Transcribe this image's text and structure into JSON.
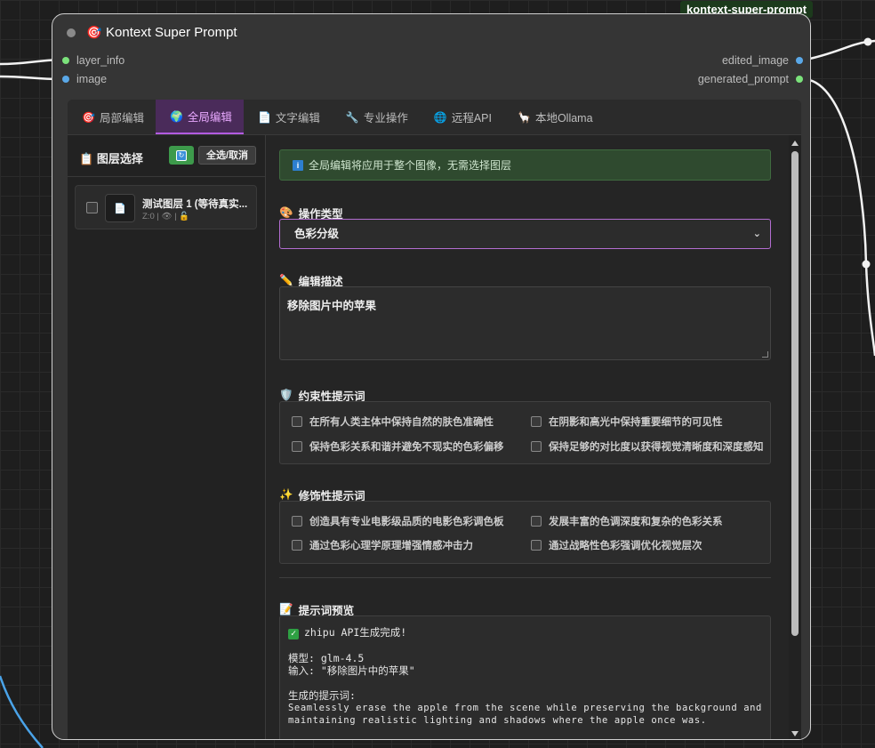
{
  "node": {
    "tag": "kontext-super-prompt",
    "title_icon": "🎯",
    "title": "Kontext Super Prompt",
    "inputs": [
      {
        "label": "layer_info",
        "color": "#7be27b"
      },
      {
        "label": "image",
        "color": "#5aa8e8"
      }
    ],
    "outputs": [
      {
        "label": "edited_image",
        "color": "#5aa8e8"
      },
      {
        "label": "generated_prompt",
        "color": "#7be27b"
      }
    ]
  },
  "tabs": [
    {
      "icon": "🎯",
      "label": "局部编辑"
    },
    {
      "icon": "🌍",
      "label": "全局编辑"
    },
    {
      "icon": "📄",
      "label": "文字编辑"
    },
    {
      "icon": "🔧",
      "label": "专业操作"
    },
    {
      "icon": "🌐",
      "label": "远程API"
    },
    {
      "icon": "🦙",
      "label": "本地Ollama"
    }
  ],
  "active_tab": "全局编辑",
  "layer_panel": {
    "icon": "📋",
    "title": "图层选择",
    "refresh_icon": "refresh-icon",
    "select_all_label": "全选/取消",
    "layers": [
      {
        "name": "测试图层 1 (等待真实...",
        "meta": "Z:0 | 👁 | 🔓",
        "icon": "📄"
      }
    ]
  },
  "global_edit": {
    "info": "全局编辑将应用于整个图像，无需选择图层",
    "operation_label": "操作类型",
    "operation_icon": "🎨",
    "operation_value": "色彩分级",
    "description_label": "编辑描述",
    "description_icon": "✏️",
    "description_value": "移除图片中的苹果",
    "constraint_label": "约束性提示词",
    "constraint_icon": "🛡️",
    "constraints": [
      "在所有人类主体中保持自然的肤色准确性",
      "在阴影和高光中保持重要细节的可见性",
      "保持色彩关系和谐并避免不现实的色彩偏移",
      "保持足够的对比度以获得视觉清晰度和深度感知"
    ],
    "decorative_label": "修饰性提示词",
    "decorative_icon": "✨",
    "decoratives": [
      "创造具有专业电影级品质的电影色彩调色板",
      "发展丰富的色调深度和复杂的色彩关系",
      "通过色彩心理学原理增强情感冲击力",
      "通过战略性色彩强调优化视觉层次"
    ],
    "preview_label": "提示词预览",
    "preview_icon": "📝",
    "preview": {
      "status": "zhipu API生成完成!",
      "model_line": "模型: glm-4.5",
      "input_line": "输入: \"移除图片中的苹果\"",
      "generated_label": "生成的提示词:",
      "generated_line1": "Seamlessly erase the apple from the scene while preserving the background and",
      "generated_line2": "maintaining realistic lighting and shadows where the apple once was."
    }
  }
}
